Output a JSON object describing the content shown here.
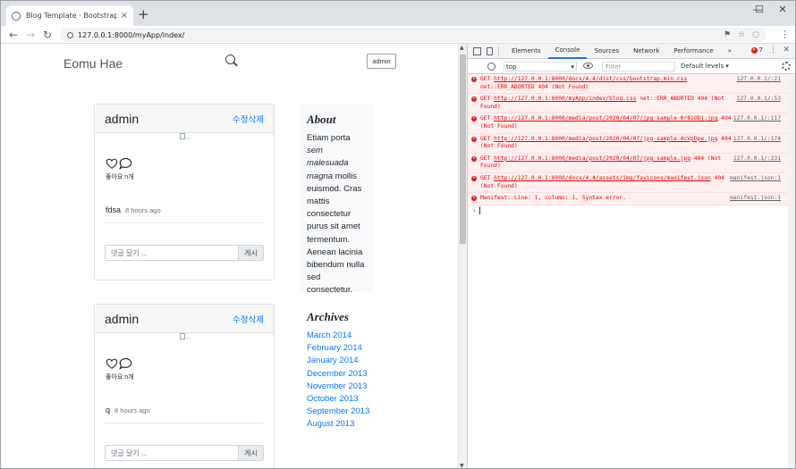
{
  "browser": {
    "tab_title": "Blog Template · Bootstrap",
    "tab_close": "×",
    "new_tab": "+",
    "url": "127.0.0.1:8000/myApp/index/",
    "window_controls": [
      "—",
      "☐",
      "✕"
    ]
  },
  "page": {
    "brand": "Eomu Hae",
    "admin_button": "admin",
    "posts": [
      {
        "author": "admin",
        "actions": "수정삭제",
        "image_alt": "...",
        "likes": "좋아요 n개",
        "text": "fdsa",
        "time": "8 hours ago",
        "comment_placeholder": "댓글 달기 ...",
        "submit": "게시"
      },
      {
        "author": "admin",
        "actions": "수정삭제",
        "image_alt": "...",
        "likes": "좋아요 n개",
        "text": "q",
        "time": "8 hours ago",
        "comment_placeholder": "댓글 달기 ...",
        "submit": "게시"
      }
    ],
    "about": {
      "title": "About",
      "text_pre": "Etiam porta ",
      "text_em": "sem malesuada magna",
      "text_post": " mollis euismod. Cras mattis consectetur purus sit amet fermentum. Aenean lacinia bibendum nulla sed consectetur."
    },
    "archives": {
      "title": "Archives",
      "items": [
        "March 2014",
        "February 2014",
        "January 2014",
        "December 2013",
        "November 2013",
        "October 2013",
        "September 2013",
        "August 2013"
      ]
    }
  },
  "devtools": {
    "tabs": [
      "Elements",
      "Console",
      "Sources",
      "Network",
      "Performance"
    ],
    "more_tabs": "»",
    "active_tab": "Console",
    "error_count": "7",
    "context": "top",
    "filter_placeholder": "Filter",
    "levels": "Default levels ▾",
    "messages": [
      {
        "method": "GET",
        "url": "http://127.0.0.1:8000/docs/4.4/dist/css/bootstrap.min.css",
        "error": " net::ERR_ABORTED 404 (Not Found)",
        "source": "127.0.0.1/:21"
      },
      {
        "method": "GET",
        "url": "http://127.0.0.1:8000/myApp/index/blog.css",
        "error": " net::ERR_ABORTED 404 (Not Found)",
        "source": "127.0.0.1/:53"
      },
      {
        "method": "GET",
        "url": "http://127.0.0.1:8000/media/post/2020/04/07/jpg_sample_0r8iODj.jpg",
        "error": " 404 (Not Found)",
        "source": "127.0.0.1/:117"
      },
      {
        "method": "GET",
        "url": "http://127.0.0.1:8000/media/post/2020/04/07/jpg_sample_4cVpDpe.jpg",
        "error": " 404 (Not Found)",
        "source": "127.0.0.1/:174"
      },
      {
        "method": "GET",
        "url": "http://127.0.0.1:8000/media/post/2020/04/07/jpg_sample.jpg",
        "error": " 404 (Not Found)",
        "source": "127.0.0.1/:231"
      },
      {
        "method": "GET",
        "url": "http://127.0.0.1:8000/docs/4.4/assets/img/favicons/manifest.json",
        "error": " 404 (Not Found)",
        "source": "manifest.json:1"
      },
      {
        "method": "",
        "url": "",
        "error": "Manifest: Line: 1, column: 1, Syntax error.",
        "source": "manifest.json:1"
      }
    ],
    "prompt": "›"
  },
  "colors": {
    "link": "#007bff",
    "error_text": "#e00000",
    "error_bg": "#fff0f0",
    "devtools_active": "#1a73e8"
  }
}
